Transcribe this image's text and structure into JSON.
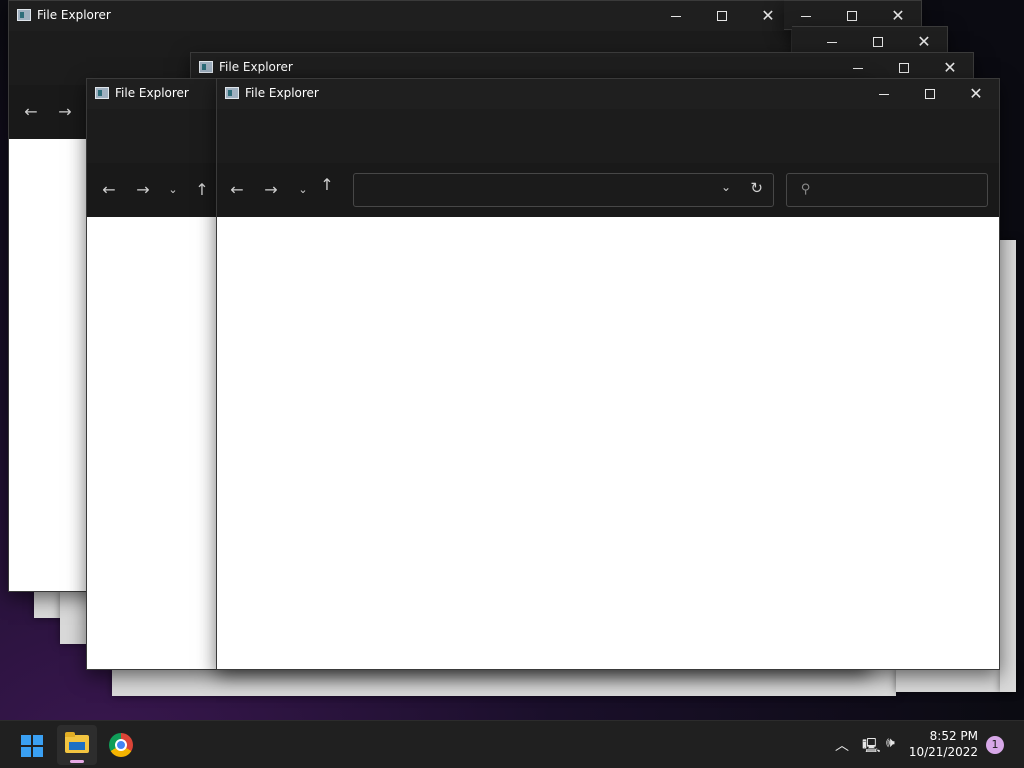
{
  "window_title": "File Explorer",
  "windows": [
    {
      "title": "File Explorer"
    },
    {
      "title": "File Explorer"
    },
    {
      "title": "File Explorer"
    },
    {
      "title": "File Explorer"
    }
  ],
  "active_window": {
    "title": "File Explorer",
    "address_value": "",
    "search_placeholder": ""
  },
  "taskbar": {
    "time": "8:52 PM",
    "date": "10/21/2022",
    "notification_count": "1",
    "apps": [
      "start",
      "file-explorer",
      "chrome"
    ]
  }
}
